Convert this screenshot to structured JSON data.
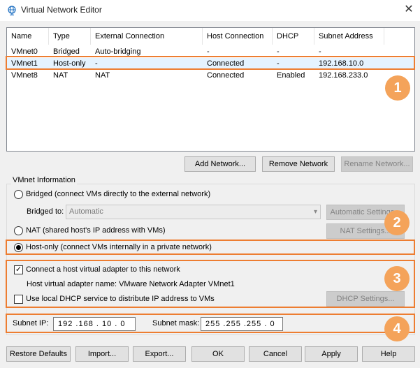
{
  "window": {
    "title": "Virtual Network Editor"
  },
  "table": {
    "columns": [
      "Name",
      "Type",
      "External Connection",
      "Host Connection",
      "DHCP",
      "Subnet Address"
    ],
    "rows": [
      [
        "VMnet0",
        "Bridged",
        "Auto-bridging",
        "-",
        "-",
        "-"
      ],
      [
        "VMnet1",
        "Host-only",
        "-",
        "Connected",
        "-",
        "192.168.10.0"
      ],
      [
        "VMnet8",
        "NAT",
        "NAT",
        "Connected",
        "Enabled",
        "192.168.233.0"
      ]
    ],
    "selected_row": 1
  },
  "network_buttons": {
    "add": "Add Network...",
    "remove": "Remove Network",
    "rename": "Rename Network..."
  },
  "vmnet_info": {
    "label": "VMnet Information",
    "bridged_label": "Bridged (connect VMs directly to the external network)",
    "bridged_to_label": "Bridged to:",
    "bridged_to_value": "Automatic",
    "auto_settings": "Automatic Settings...",
    "nat_label": "NAT (shared host's IP address with VMs)",
    "nat_settings": "NAT Settings...",
    "hostonly_label": "Host-only (connect VMs internally in a private network)",
    "selected_mode": "host-only",
    "connect_adapter_label": "Connect a host virtual adapter to this network",
    "connect_adapter_checked": true,
    "adapter_name_label": "Host virtual adapter name: VMware Network Adapter VMnet1",
    "dhcp_label": "Use local DHCP service to distribute IP address to VMs",
    "dhcp_checked": false,
    "dhcp_settings": "DHCP Settings...",
    "subnet_ip_label": "Subnet IP:",
    "subnet_ip": "192 .168 . 10  .  0",
    "subnet_mask_label": "Subnet mask:",
    "subnet_mask": "255 .255 .255 .  0"
  },
  "footer": {
    "restore": "Restore Defaults",
    "import": "Import...",
    "export": "Export...",
    "ok": "OK",
    "cancel": "Cancel",
    "apply": "Apply",
    "help": "Help"
  },
  "callouts": [
    "1",
    "2",
    "3",
    "4"
  ],
  "colors": {
    "highlight": "#ed7d31",
    "badge": "#f4a35a",
    "selection": "#e5f3ff"
  }
}
